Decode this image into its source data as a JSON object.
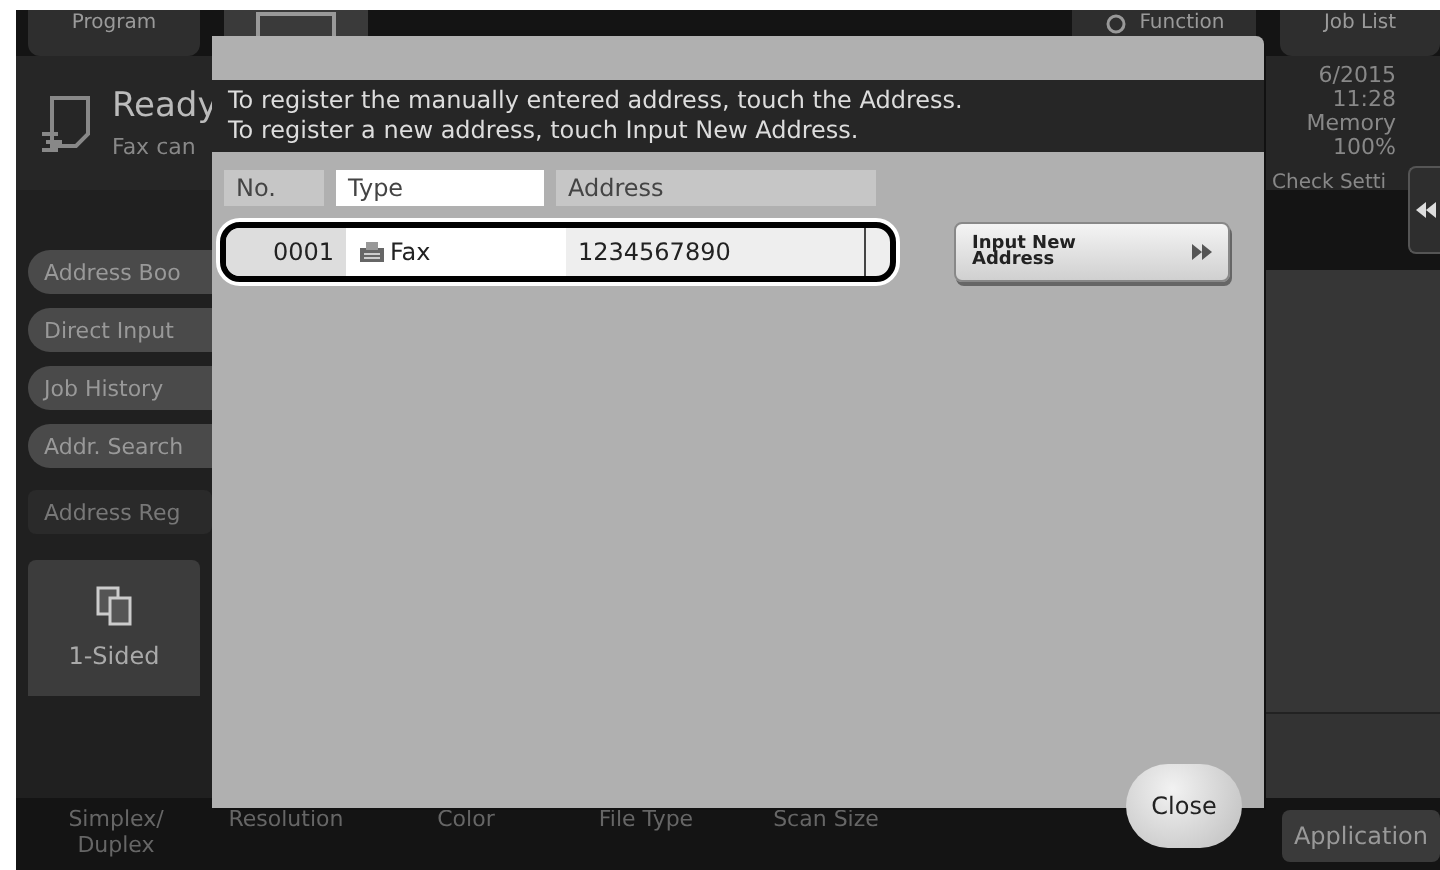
{
  "top_tabs": [
    {
      "label": "Program",
      "kind": "text"
    },
    {
      "kind": "icon"
    },
    {
      "label": "Function",
      "kind": "search"
    },
    {
      "label": "Job List",
      "kind": "text"
    }
  ],
  "status": {
    "title": "Ready",
    "subtitle": "Fax can",
    "date": "6/2015",
    "time": "11:28",
    "memory_label": "Memory",
    "memory_value": "100%",
    "check": "Check Setti"
  },
  "sidebar": {
    "items": [
      {
        "label": "Address Boo",
        "selected": false
      },
      {
        "label": "Direct Input",
        "selected": false
      },
      {
        "label": "Job History",
        "selected": false
      },
      {
        "label": "Addr. Search",
        "selected": false
      },
      {
        "label": "Address Reg",
        "selected": true
      }
    ]
  },
  "tile": {
    "label": "1-Sided"
  },
  "bottom_labels": [
    "Simplex/ Duplex",
    "Resolution",
    "Color",
    "File Type",
    "Scan Size"
  ],
  "application_button": "Application",
  "dialog": {
    "message": [
      "To register the manually entered address, touch the Address.",
      "To register a new address, touch Input New Address."
    ],
    "columns": [
      {
        "label": "No.",
        "selected": false
      },
      {
        "label": "Type",
        "selected": true
      },
      {
        "label": "Address",
        "selected": false
      }
    ],
    "rows": [
      {
        "no": "0001",
        "type": "Fax",
        "address": "1234567890",
        "selected": true
      }
    ],
    "input_new_button": "Input New Address",
    "close_button": "Close"
  }
}
